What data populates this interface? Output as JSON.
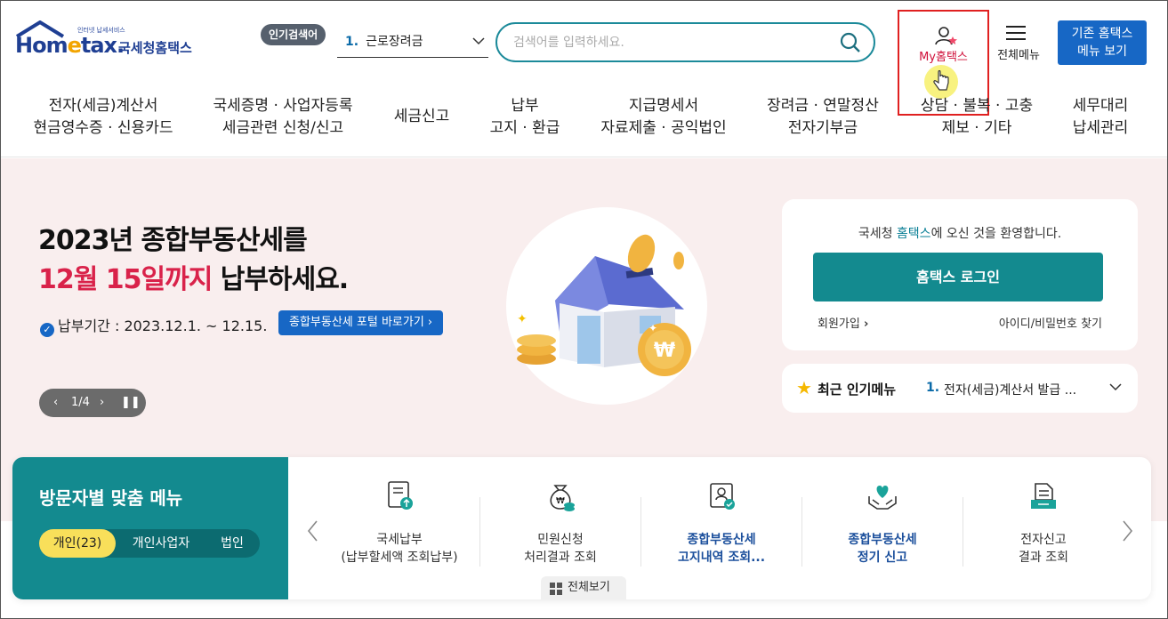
{
  "header": {
    "logo_small": "인터넷 납세서비스",
    "logo_word_prefix": "Hom",
    "logo_word_e": "e",
    "logo_word_suffix": "tax.",
    "logo_kr": "국세청홈택스",
    "popular_badge": "인기검색어",
    "popular_rank": "1.",
    "popular_term": "근로장려금",
    "search_placeholder": "검색어를 입력하세요.",
    "my_hometax": "My홈택스",
    "all_menu": "전체메뉴",
    "old_hometax_line1": "기존 홈택스",
    "old_hometax_line2": "메뉴 보기"
  },
  "gnb": [
    {
      "line1": "전자(세금)계산서",
      "line2": "현금영수증 · 신용카드"
    },
    {
      "line1": "국세증명 · 사업자등록",
      "line2": "세금관련 신청/신고"
    },
    {
      "line1": "세금신고",
      "line2": ""
    },
    {
      "line1": "납부",
      "line2": "고지 · 환급"
    },
    {
      "line1": "지급명세서",
      "line2": "자료제출 · 공익법인"
    },
    {
      "line1": "장려금 · 연말정산",
      "line2": "전자기부금"
    },
    {
      "line1": "상담 · 불복 · 고충",
      "line2": "제보 · 기타"
    },
    {
      "line1": "세무대리",
      "line2": "납세관리"
    }
  ],
  "hero": {
    "title_line1": "2023년 종합부동산세를",
    "title_line2_red": "12월 15일까지",
    "title_line2_rest": " 납부하세요.",
    "period": "납부기간 : 2023.12.1. ~ 12.15.",
    "portal_button": "종합부동산세 포털 바로가기",
    "pager": "1/4"
  },
  "login": {
    "welcome_prefix": "국세청 ",
    "welcome_highlight": "홈택스",
    "welcome_suffix": "에 오신 것을 환영합니다.",
    "login_button": "홈택스 로그인",
    "join": "회원가입",
    "find": "아이디/비밀번호 찾기"
  },
  "recent": {
    "title": "최근 인기메뉴",
    "rank": "1.",
    "value": "전자(세금)계산서 발급 ..."
  },
  "visitor": {
    "title": "방문자별 맞춤 메뉴",
    "tabs": [
      "개인(23)",
      "개인사업자",
      "법인"
    ],
    "items": [
      {
        "line1": "국세납부",
        "line2": "(납부할세액 조회납부)",
        "icon": "document-upload-icon"
      },
      {
        "line1": "민원신청",
        "line2": "처리결과 조회",
        "icon": "money-bag-icon"
      },
      {
        "line1": "종합부동산세",
        "line2": "고지내역 조회...",
        "icon": "house-certificate-icon"
      },
      {
        "line1": "종합부동산세",
        "line2": "정기 신고",
        "icon": "heart-hands-icon"
      },
      {
        "line1": "전자신고",
        "line2": "결과 조회",
        "icon": "document-tray-icon"
      }
    ],
    "all_view": "전체보기"
  },
  "colors": {
    "brand_teal": "#138a8f",
    "brand_blue": "#1767c5",
    "accent_red": "#d9224a",
    "highlight_box": "#e02020"
  }
}
